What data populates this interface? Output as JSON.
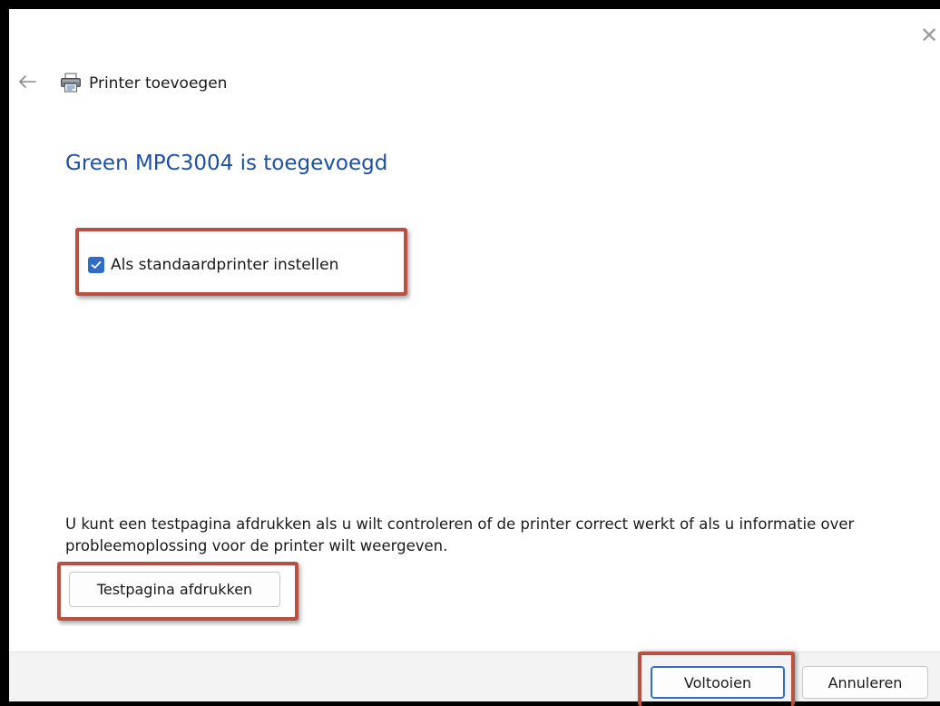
{
  "window": {
    "title": "Printer toevoegen",
    "close_glyph": "✕",
    "back_glyph": "←"
  },
  "main": {
    "heading": "Green MPC3004 is toegevoegd",
    "default_printer_checkbox": {
      "label": "Als standaardprinter instellen",
      "checked": true
    },
    "info_text": "U kunt een testpagina afdrukken als u wilt controleren of de printer correct werkt of als u informatie over probleemoplossing voor de printer wilt weergeven.",
    "test_page_button": "Testpagina afdrukken"
  },
  "footer": {
    "finish_button": "Voltooien",
    "cancel_button": "Annuleren"
  },
  "colors": {
    "heading": "#1d4fa3",
    "accent": "#2f6cc4",
    "highlight": "#b85142",
    "footer_bg": "#f3f3f3"
  },
  "icons": {
    "back": "arrow-left-icon",
    "printer": "printer-icon",
    "close": "close-icon",
    "checkmark": "checkmark-icon"
  }
}
